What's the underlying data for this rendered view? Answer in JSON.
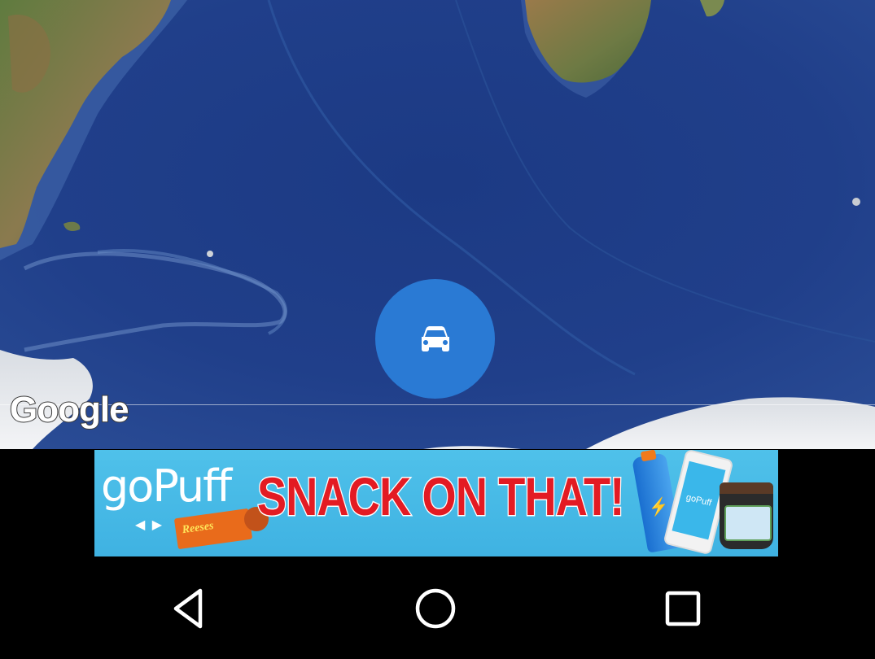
{
  "map": {
    "attribution": "Google",
    "fab_icon": "car-icon",
    "ocean_color": "#1f3f86"
  },
  "ad": {
    "brand": "goPuff",
    "headline": "SNACK ON THAT!",
    "candy_label": "Reeses",
    "phone_label": "goPuff",
    "background_color": "#4fc1ea",
    "headline_color": "#e31b23"
  },
  "nav": {
    "back_icon": "back-triangle-icon",
    "home_icon": "home-circle-icon",
    "recents_icon": "recents-square-icon"
  }
}
